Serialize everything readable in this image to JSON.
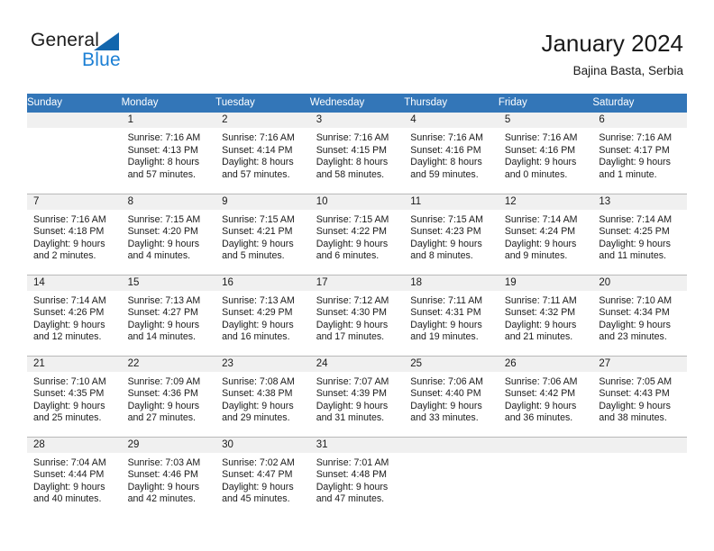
{
  "brand": {
    "name_part1": "General",
    "name_part2": "Blue",
    "accent_color": "#1b7fd4",
    "triangle_color": "#1266ad"
  },
  "header": {
    "title": "January 2024",
    "subtitle": "Bajina Basta, Serbia",
    "header_bg_color": "#3376b8",
    "band_bg_color": "#f0f0f0"
  },
  "calendar": {
    "weekday_headers": [
      "Sunday",
      "Monday",
      "Tuesday",
      "Wednesday",
      "Thursday",
      "Friday",
      "Saturday"
    ],
    "weeks": [
      [
        {
          "day": "",
          "lines": []
        },
        {
          "day": "1",
          "lines": [
            "Sunrise: 7:16 AM",
            "Sunset: 4:13 PM",
            "Daylight: 8 hours",
            "and 57 minutes."
          ]
        },
        {
          "day": "2",
          "lines": [
            "Sunrise: 7:16 AM",
            "Sunset: 4:14 PM",
            "Daylight: 8 hours",
            "and 57 minutes."
          ]
        },
        {
          "day": "3",
          "lines": [
            "Sunrise: 7:16 AM",
            "Sunset: 4:15 PM",
            "Daylight: 8 hours",
            "and 58 minutes."
          ]
        },
        {
          "day": "4",
          "lines": [
            "Sunrise: 7:16 AM",
            "Sunset: 4:16 PM",
            "Daylight: 8 hours",
            "and 59 minutes."
          ]
        },
        {
          "day": "5",
          "lines": [
            "Sunrise: 7:16 AM",
            "Sunset: 4:16 PM",
            "Daylight: 9 hours",
            "and 0 minutes."
          ]
        },
        {
          "day": "6",
          "lines": [
            "Sunrise: 7:16 AM",
            "Sunset: 4:17 PM",
            "Daylight: 9 hours",
            "and 1 minute."
          ]
        }
      ],
      [
        {
          "day": "7",
          "lines": [
            "Sunrise: 7:16 AM",
            "Sunset: 4:18 PM",
            "Daylight: 9 hours",
            "and 2 minutes."
          ]
        },
        {
          "day": "8",
          "lines": [
            "Sunrise: 7:15 AM",
            "Sunset: 4:20 PM",
            "Daylight: 9 hours",
            "and 4 minutes."
          ]
        },
        {
          "day": "9",
          "lines": [
            "Sunrise: 7:15 AM",
            "Sunset: 4:21 PM",
            "Daylight: 9 hours",
            "and 5 minutes."
          ]
        },
        {
          "day": "10",
          "lines": [
            "Sunrise: 7:15 AM",
            "Sunset: 4:22 PM",
            "Daylight: 9 hours",
            "and 6 minutes."
          ]
        },
        {
          "day": "11",
          "lines": [
            "Sunrise: 7:15 AM",
            "Sunset: 4:23 PM",
            "Daylight: 9 hours",
            "and 8 minutes."
          ]
        },
        {
          "day": "12",
          "lines": [
            "Sunrise: 7:14 AM",
            "Sunset: 4:24 PM",
            "Daylight: 9 hours",
            "and 9 minutes."
          ]
        },
        {
          "day": "13",
          "lines": [
            "Sunrise: 7:14 AM",
            "Sunset: 4:25 PM",
            "Daylight: 9 hours",
            "and 11 minutes."
          ]
        }
      ],
      [
        {
          "day": "14",
          "lines": [
            "Sunrise: 7:14 AM",
            "Sunset: 4:26 PM",
            "Daylight: 9 hours",
            "and 12 minutes."
          ]
        },
        {
          "day": "15",
          "lines": [
            "Sunrise: 7:13 AM",
            "Sunset: 4:27 PM",
            "Daylight: 9 hours",
            "and 14 minutes."
          ]
        },
        {
          "day": "16",
          "lines": [
            "Sunrise: 7:13 AM",
            "Sunset: 4:29 PM",
            "Daylight: 9 hours",
            "and 16 minutes."
          ]
        },
        {
          "day": "17",
          "lines": [
            "Sunrise: 7:12 AM",
            "Sunset: 4:30 PM",
            "Daylight: 9 hours",
            "and 17 minutes."
          ]
        },
        {
          "day": "18",
          "lines": [
            "Sunrise: 7:11 AM",
            "Sunset: 4:31 PM",
            "Daylight: 9 hours",
            "and 19 minutes."
          ]
        },
        {
          "day": "19",
          "lines": [
            "Sunrise: 7:11 AM",
            "Sunset: 4:32 PM",
            "Daylight: 9 hours",
            "and 21 minutes."
          ]
        },
        {
          "day": "20",
          "lines": [
            "Sunrise: 7:10 AM",
            "Sunset: 4:34 PM",
            "Daylight: 9 hours",
            "and 23 minutes."
          ]
        }
      ],
      [
        {
          "day": "21",
          "lines": [
            "Sunrise: 7:10 AM",
            "Sunset: 4:35 PM",
            "Daylight: 9 hours",
            "and 25 minutes."
          ]
        },
        {
          "day": "22",
          "lines": [
            "Sunrise: 7:09 AM",
            "Sunset: 4:36 PM",
            "Daylight: 9 hours",
            "and 27 minutes."
          ]
        },
        {
          "day": "23",
          "lines": [
            "Sunrise: 7:08 AM",
            "Sunset: 4:38 PM",
            "Daylight: 9 hours",
            "and 29 minutes."
          ]
        },
        {
          "day": "24",
          "lines": [
            "Sunrise: 7:07 AM",
            "Sunset: 4:39 PM",
            "Daylight: 9 hours",
            "and 31 minutes."
          ]
        },
        {
          "day": "25",
          "lines": [
            "Sunrise: 7:06 AM",
            "Sunset: 4:40 PM",
            "Daylight: 9 hours",
            "and 33 minutes."
          ]
        },
        {
          "day": "26",
          "lines": [
            "Sunrise: 7:06 AM",
            "Sunset: 4:42 PM",
            "Daylight: 9 hours",
            "and 36 minutes."
          ]
        },
        {
          "day": "27",
          "lines": [
            "Sunrise: 7:05 AM",
            "Sunset: 4:43 PM",
            "Daylight: 9 hours",
            "and 38 minutes."
          ]
        }
      ],
      [
        {
          "day": "28",
          "lines": [
            "Sunrise: 7:04 AM",
            "Sunset: 4:44 PM",
            "Daylight: 9 hours",
            "and 40 minutes."
          ]
        },
        {
          "day": "29",
          "lines": [
            "Sunrise: 7:03 AM",
            "Sunset: 4:46 PM",
            "Daylight: 9 hours",
            "and 42 minutes."
          ]
        },
        {
          "day": "30",
          "lines": [
            "Sunrise: 7:02 AM",
            "Sunset: 4:47 PM",
            "Daylight: 9 hours",
            "and 45 minutes."
          ]
        },
        {
          "day": "31",
          "lines": [
            "Sunrise: 7:01 AM",
            "Sunset: 4:48 PM",
            "Daylight: 9 hours",
            "and 47 minutes."
          ]
        },
        {
          "day": "",
          "lines": []
        },
        {
          "day": "",
          "lines": []
        },
        {
          "day": "",
          "lines": []
        }
      ]
    ]
  }
}
